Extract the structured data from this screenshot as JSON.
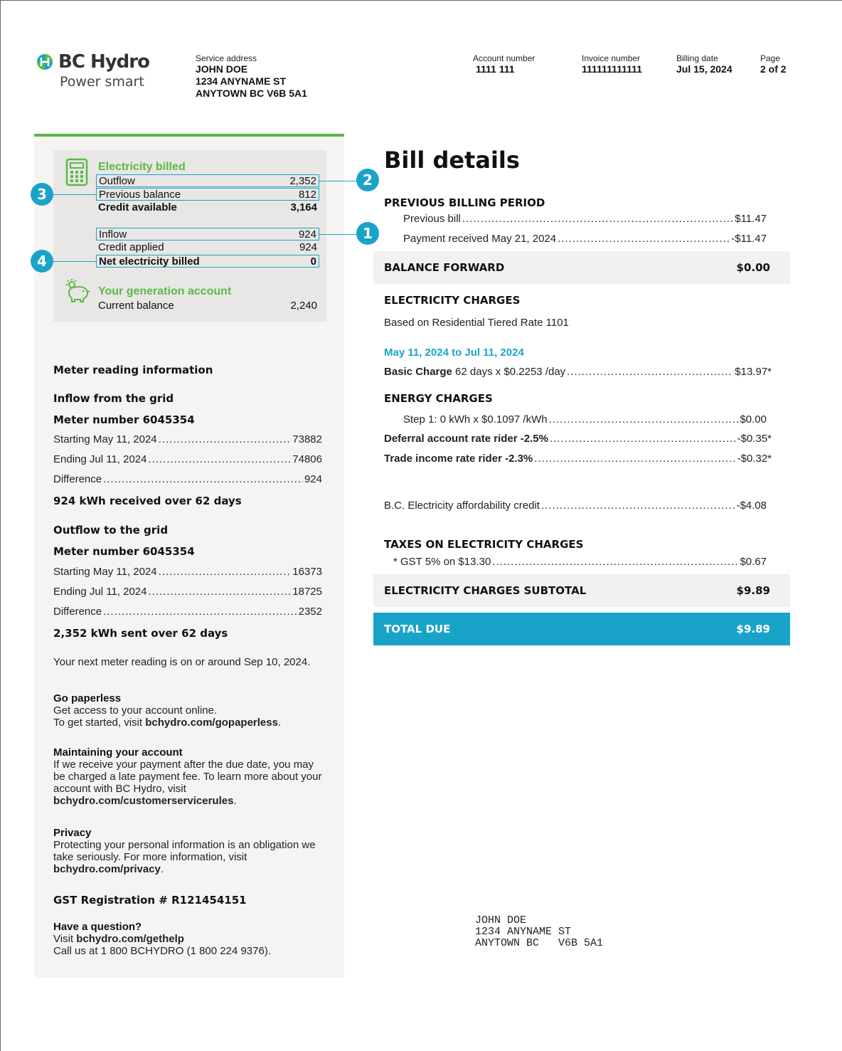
{
  "brand": {
    "name": "BC Hydro",
    "tagline": "Power smart",
    "green": "#5bb947",
    "blue": "#1aa3c9"
  },
  "header": {
    "service_address_label": "Service address",
    "service_name": "JOHN DOE",
    "service_street": "1234 ANYNAME ST",
    "service_city": "ANYTOWN BC  V6B 5A1",
    "account_label": "Account number",
    "account_value": "1111 111",
    "invoice_label": "Invoice number",
    "invoice_value": "111111111111",
    "billing_label": "Billing date",
    "billing_value": "Jul 15, 2024",
    "page_label": "Page",
    "page_value": "2 of 2"
  },
  "summary": {
    "electricity_title": "Electricity billed",
    "rows": [
      {
        "label": "Outflow",
        "value": "2,352"
      },
      {
        "label": "Previous balance",
        "value": "812"
      },
      {
        "label": "Credit available",
        "value": "3,164"
      },
      {
        "label": "Inflow",
        "value": "924"
      },
      {
        "label": "Credit applied",
        "value": "924"
      },
      {
        "label": "Net electricity billed",
        "value": "0"
      }
    ],
    "generation_title": "Your generation account",
    "current_balance_label": "Current balance",
    "current_balance_value": "2,240",
    "badges": [
      "1",
      "2",
      "3",
      "4"
    ]
  },
  "meter": {
    "title": "Meter reading information",
    "inflow_title": "Inflow from the grid",
    "inflow_meter": "Meter number 6045354",
    "inflow_rows": [
      {
        "label": "Starting May 11, 2024",
        "value": "73882"
      },
      {
        "label": "Ending Jul 11, 2024",
        "value": "74806"
      },
      {
        "label": "Difference",
        "value": "924"
      }
    ],
    "inflow_summary": "924 kWh received over 62 days",
    "outflow_title": "Outflow to the grid",
    "outflow_meter": "Meter number 6045354",
    "outflow_rows": [
      {
        "label": "Starting May 11, 2024",
        "value": "16373"
      },
      {
        "label": "Ending Jul 11, 2024",
        "value": "18725"
      },
      {
        "label": "Difference",
        "value": "2352"
      }
    ],
    "outflow_summary": "2,352 kWh sent over 62 days",
    "next_reading": "Your next meter reading is on or around Sep 10, 2024."
  },
  "info": {
    "paperless_title": "Go paperless",
    "paperless_line1": "Get access to your account online.",
    "paperless_line2_pre": "To get started, visit ",
    "paperless_link": "bchydro.com/gopaperless",
    "paperless_line2_post": ".",
    "account_title": "Maintaining your account",
    "account_text": "If we receive your payment after the due date, you may be charged a late payment fee. To learn more about your account with BC Hydro, visit",
    "account_link": "bchydro.com/customerservicerules",
    "account_post": ".",
    "privacy_title": "Privacy",
    "privacy_text": "Protecting your personal information is an obligation we take seriously.  For more information, visit",
    "privacy_link": "bchydro.com/privacy",
    "privacy_post": ".",
    "gst_reg": "GST Registration # R121454151",
    "question_title": "Have a question?",
    "question_pre": "Visit ",
    "question_link": "bchydro.com/gethelp",
    "question_call": "Call us at 1 800 BCHYDRO (1 800 224 9376)."
  },
  "bill": {
    "title": "Bill details",
    "prev_period_title": "PREVIOUS BILLING PERIOD",
    "prev_bill_label": "Previous bill",
    "prev_bill_value": "$11.47",
    "payment_label": "Payment received May 21, 2024",
    "payment_value": "-$11.47",
    "balance_forward_label": "BALANCE FORWARD",
    "balance_forward_value": "$0.00",
    "elec_title": "ELECTRICITY CHARGES",
    "rate_text": "Based on Residential Tiered Rate 1101",
    "period": "May 11, 2024 to Jul 11, 2024",
    "basic_label_bold": "Basic Charge",
    "basic_label": "  62 days x $0.2253 /day",
    "basic_value": "$13.97*",
    "energy_title": "ENERGY CHARGES",
    "step1_label": "Step 1:  0 kWh x $0.1097 /kWh",
    "step1_value": "$0.00",
    "deferral_label": "Deferral account rate rider -2.5%",
    "deferral_value": "-$0.35*",
    "trade_label": "Trade income rate rider -2.3%",
    "trade_value": "-$0.32*",
    "afford_label": "B.C. Electricity affordability credit",
    "afford_value": "-$4.08",
    "taxes_title": "TAXES ON ELECTRICITY CHARGES",
    "gst_label": "* GST 5% on $13.30",
    "gst_value": "$0.67",
    "subtotal_label": "ELECTRICITY CHARGES SUBTOTAL",
    "subtotal_value": "$9.89",
    "total_label": "TOTAL DUE",
    "total_value": "$9.89"
  },
  "mailing": {
    "line1": "JOHN DOE",
    "line2": "1234 ANYNAME ST",
    "line3": "ANYTOWN BC   V6B 5A1"
  }
}
